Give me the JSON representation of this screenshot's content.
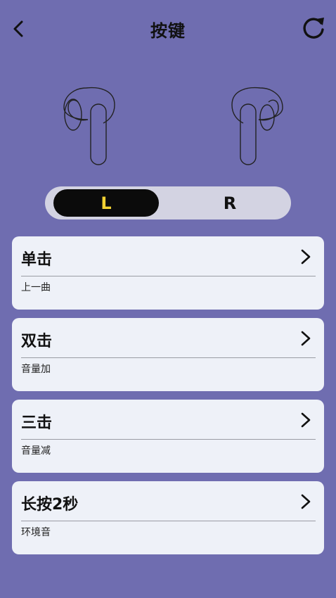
{
  "header": {
    "title": "按键",
    "back_icon": "back-arrow-icon",
    "refresh_icon": "refresh-icon"
  },
  "earbuds": {
    "left_icon": "left-earbud-icon",
    "right_icon": "right-earbud-icon"
  },
  "side_toggle": {
    "left_label": "L",
    "right_label": "R",
    "selected": "L",
    "selected_bg": "#0b0b0b",
    "selected_fg": "#f2d233"
  },
  "gestures": [
    {
      "label": "单击",
      "action": "上一曲"
    },
    {
      "label": "双击",
      "action": "音量加"
    },
    {
      "label": "三击",
      "action": "音量减"
    },
    {
      "label": "长按2秒",
      "action": "环境音"
    }
  ],
  "colors": {
    "background": "#6f6db0",
    "card": "#eef1f8",
    "toggle_track": "#d3d3e2"
  }
}
